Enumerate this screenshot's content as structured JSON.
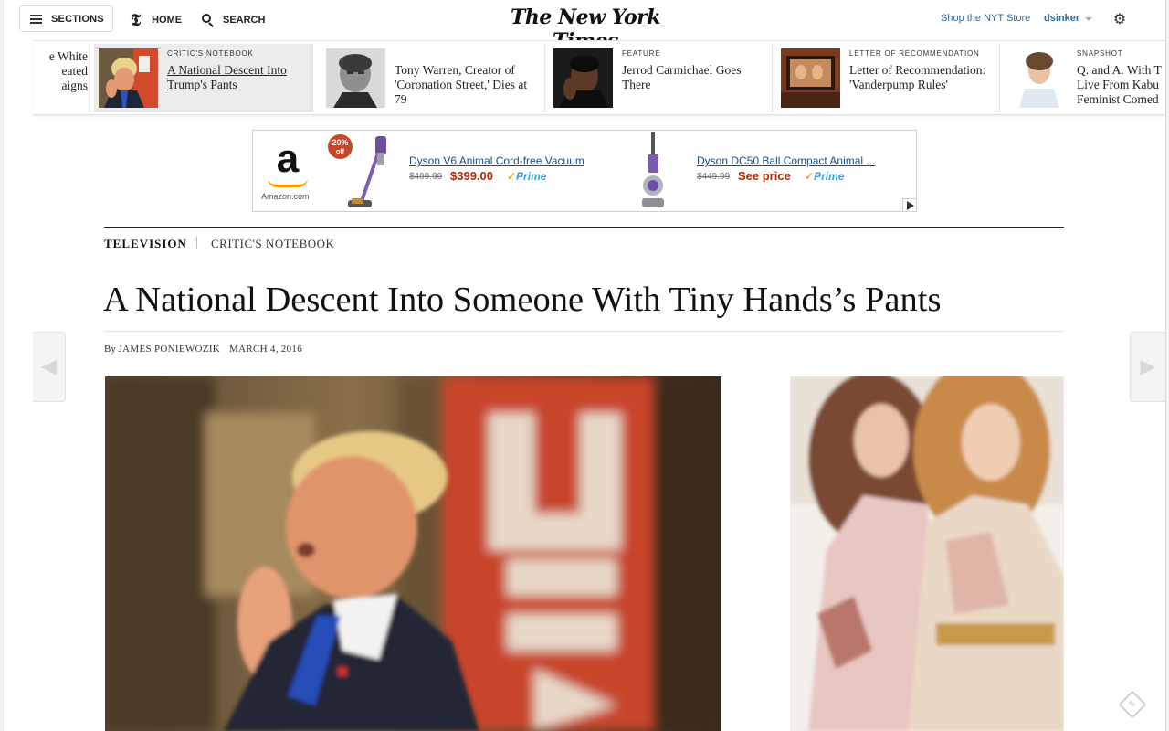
{
  "masthead": {
    "sections_label": "SECTIONS",
    "home_label": "HOME",
    "home_icon_glyph": "𝕿",
    "search_label": "SEARCH",
    "logo_text": "The New York Times",
    "shop_label": "Shop the NYT Store",
    "username": "dsinker",
    "settings_glyph": "⚙"
  },
  "ribbon": {
    "items": [
      {
        "kicker": "",
        "headline": "e White\neated\naigns"
      },
      {
        "kicker": "CRITIC'S NOTEBOOK",
        "headline": "A National Descent Into Trump's Pants",
        "active": true
      },
      {
        "kicker": "",
        "headline": "Tony Warren, Creator of 'Coronation Street,' Dies at 79"
      },
      {
        "kicker": "FEATURE",
        "headline": "Jerrod Carmichael Goes There"
      },
      {
        "kicker": "LETTER OF RECOMMENDATION",
        "headline": "Letter of Recommendation: 'Vanderpump Rules'"
      },
      {
        "kicker": "SNAPSHOT",
        "headline": "Q. and A. With T Live From Kabu Feminist Comed"
      }
    ]
  },
  "ad": {
    "brand_letter": "a",
    "domain": "Amazon.com",
    "badge_pct": "20%",
    "badge_off": "off",
    "products": [
      {
        "name": "Dyson V6 Animal Cord-free Vacuum",
        "old_price": "$499.99",
        "new_price": "$399.00",
        "prime": "Prime"
      },
      {
        "name": "Dyson DC50 Ball Compact Animal ...",
        "old_price": "$449.99",
        "new_price": "See price",
        "prime": "Prime"
      }
    ]
  },
  "article": {
    "section": "TELEVISION",
    "subsection": "CRITIC'S NOTEBOOK",
    "headline": "A National Descent Into Someone With Tiny Hands’s Pants",
    "byline_prefix": "By",
    "author": "JAMES PONIEWOZIK",
    "date": "MARCH 4, 2016"
  },
  "nav": {
    "prev_glyph": "◀",
    "next_glyph": "▶"
  },
  "colors": {
    "link_blue": "#326891",
    "amazon_orange": "#ff9900",
    "price_red": "#b12704",
    "prime_blue": "#3aa0d8"
  }
}
